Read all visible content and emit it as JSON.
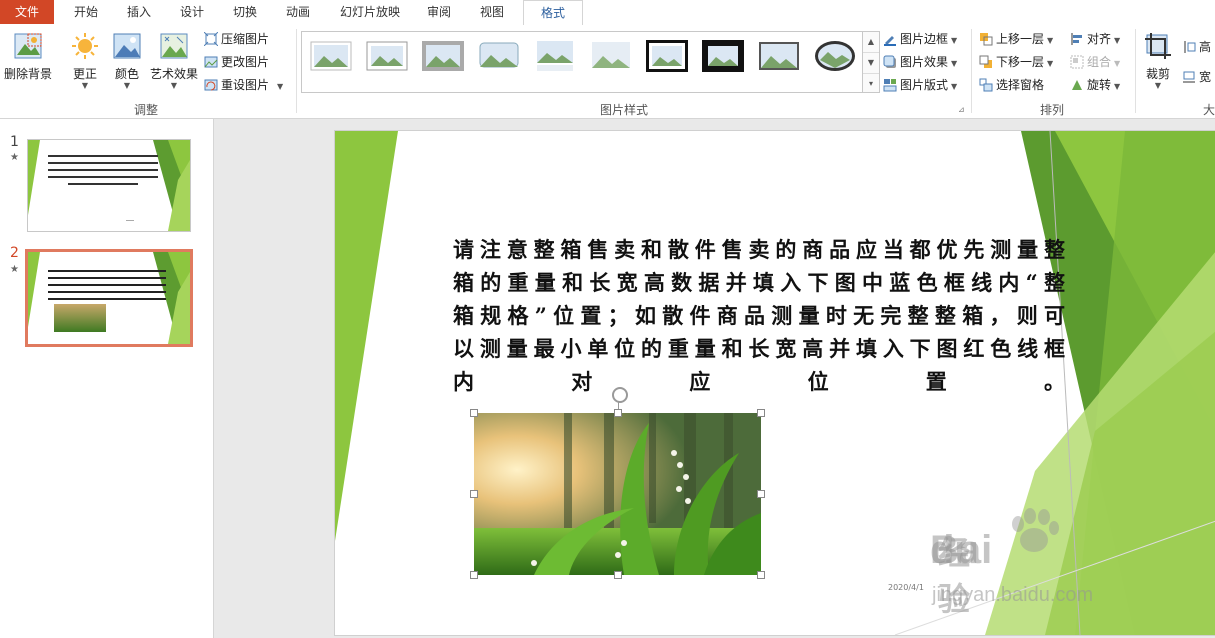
{
  "tabs": {
    "file": "文件",
    "home": "开始",
    "insert": "插入",
    "design": "设计",
    "transitions": "切换",
    "animations": "动画",
    "slideshow": "幻灯片放映",
    "review": "审阅",
    "view": "视图",
    "format": "格式"
  },
  "ribbon": {
    "adjust": {
      "remove_bg": "删除背景",
      "corrections": "更正",
      "color": "颜色",
      "artistic": "艺术效果",
      "compress": "压缩图片",
      "change": "更改图片",
      "reset": "重设图片",
      "label": "调整"
    },
    "styles": {
      "border": "图片边框",
      "effects": "图片效果",
      "layout": "图片版式",
      "label": "图片样式"
    },
    "arrange": {
      "bring_forward": "上移一层",
      "send_backward": "下移一层",
      "selection_pane": "选择窗格",
      "align": "对齐",
      "group": "组合",
      "rotate": "旋转",
      "label": "排列"
    },
    "size": {
      "crop": "裁剪",
      "height": "高",
      "width": "宽",
      "label": "大"
    }
  },
  "thumbnails": [
    {
      "number": "1",
      "star": "★"
    },
    {
      "number": "2",
      "star": "★"
    }
  ],
  "slide": {
    "lines": [
      "请注意整箱售卖和散件售卖的商品应当都优先测量整",
      "箱的重量和长宽高数据并填入下图中蓝色框线内“整",
      "箱规格”位置；如散件商品测量时无完整整箱，则可",
      "以测量最小单位的重量和长宽高并填入下图红色线框",
      "内对应位置。"
    ],
    "date": "2020/4/1"
  },
  "watermark": {
    "brand": "Bai",
    "brand2": "du",
    "brand_cn": "经验",
    "url": "jingyan.baidu.com"
  },
  "colors": {
    "accent": "#d24726",
    "green": "#8dc63f",
    "dark_green": "#4e8a2b"
  }
}
